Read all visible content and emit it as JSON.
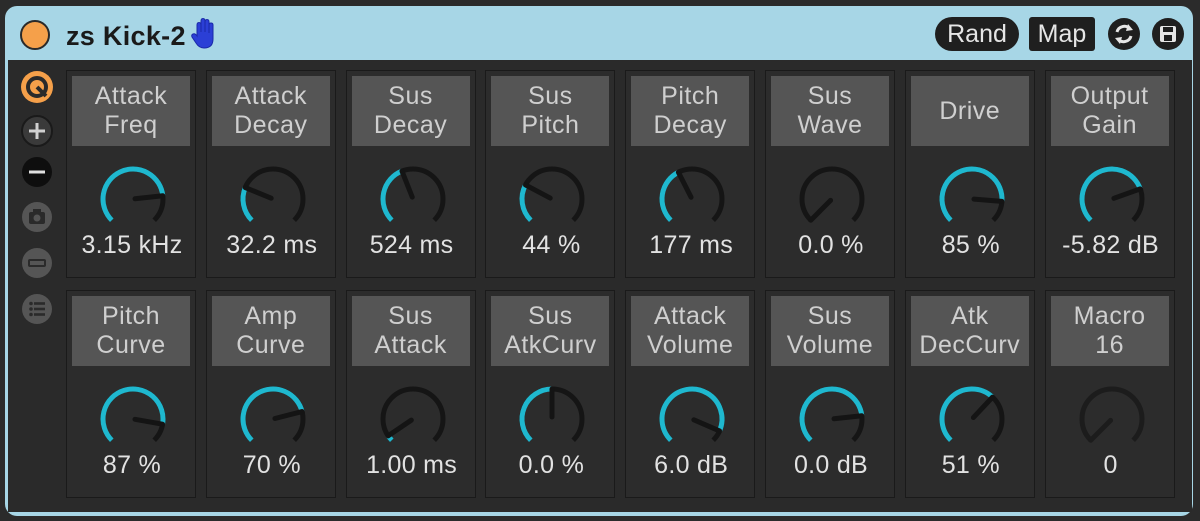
{
  "device": {
    "title": "zs Kick-2",
    "buttons": {
      "rand": "Rand",
      "map": "Map"
    },
    "colors": {
      "accent": "#1fb8cf",
      "power": "#f5a04a",
      "title_bg": "#a7d6e6",
      "label_bg": "#555555"
    },
    "side_icons": [
      "hot-swap-icon",
      "add-icon",
      "remove-icon",
      "camera-icon",
      "collapse-icon",
      "list-icon"
    ]
  },
  "knobs": [
    {
      "label": "Attack\nFreq",
      "value": "3.15 kHz",
      "fraction": 0.81
    },
    {
      "label": "Attack\nDecay",
      "value": "32.2 ms",
      "fraction": 0.25
    },
    {
      "label": "Sus\nDecay",
      "value": "524 ms",
      "fraction": 0.42
    },
    {
      "label": "Sus\nPitch",
      "value": "44 %",
      "fraction": 0.27
    },
    {
      "label": "Pitch\nDecay",
      "value": "177 ms",
      "fraction": 0.4
    },
    {
      "label": "Sus\nWave",
      "value": "0.0 %",
      "fraction": 0.0
    },
    {
      "label": "Drive",
      "value": "85 %",
      "fraction": 0.85
    },
    {
      "label": "Output\nGain",
      "value": "-5.82 dB",
      "fraction": 0.76
    },
    {
      "label": "Pitch\nCurve",
      "value": "87 %",
      "fraction": 0.87
    },
    {
      "label": "Amp\nCurve",
      "value": "70 %",
      "fraction": 0.78
    },
    {
      "label": "Sus\nAttack",
      "value": "1.00 ms",
      "fraction": 0.04
    },
    {
      "label": "Sus\nAtkCurv",
      "value": "0.0 %",
      "fraction": 0.5
    },
    {
      "label": "Attack\nVolume",
      "value": "6.0 dB",
      "fraction": 0.92
    },
    {
      "label": "Sus\nVolume",
      "value": "0.0 dB",
      "fraction": 0.81
    },
    {
      "label": "Atk\nDecCurv",
      "value": "51 %",
      "fraction": 0.66
    },
    {
      "label": "Macro\n16",
      "value": "0",
      "fraction": 0.0,
      "inactive": true
    }
  ]
}
